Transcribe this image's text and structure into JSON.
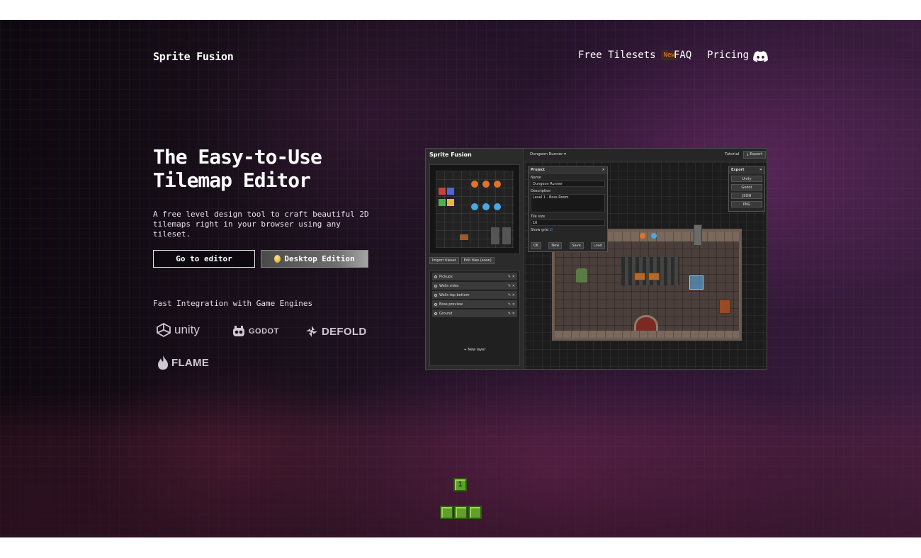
{
  "header": {
    "logo": "Sprite Fusion",
    "nav": {
      "free_tilesets": "Free Tilesets",
      "new_badge": "New",
      "faq": "FAQ",
      "pricing": "Pricing",
      "discord_icon": "discord-icon"
    }
  },
  "hero": {
    "title_line1": "The Easy-to-Use",
    "title_line2": "Tilemap Editor",
    "description": "A free level design tool to craft beautiful 2D tilemaps right in your browser using any tileset.",
    "go_to_editor": "Go to editor",
    "desktop_edition": "Desktop Edition",
    "engines_heading": "Fast Integration with Game Engines",
    "engines": {
      "unity": "unity",
      "godot": "GODOT",
      "defold": "DEFOLD",
      "flame": "FLAME"
    }
  },
  "app": {
    "title": "Sprite Fusion",
    "project_name": "Dungeon Runner",
    "tutorial": "Tutorial",
    "export": "Export",
    "import_tileset": "Import tileset",
    "edit_tiles": "Edit tiles (soon)",
    "layers": [
      "Pickups",
      "Walls sides",
      "Walls top bottom",
      "Boss preview",
      "Ground"
    ],
    "new_layer": "+ New layer",
    "project_panel": {
      "title": "Project",
      "name_label": "Name",
      "name_value": "Dungeon Runner",
      "description_label": "Description",
      "description_value": "Level 1 - Boss Room",
      "tile_size_label": "Tile size",
      "tile_size_value": "16",
      "show_grid_label": "Show grid",
      "ok": "OK",
      "new": "New",
      "save": "Save",
      "load": "Load"
    },
    "export_panel": {
      "title": "Export",
      "options": [
        "Unity",
        "Godot",
        "JSON",
        "PNG"
      ]
    }
  },
  "footer": {
    "tile_number": "1"
  }
}
